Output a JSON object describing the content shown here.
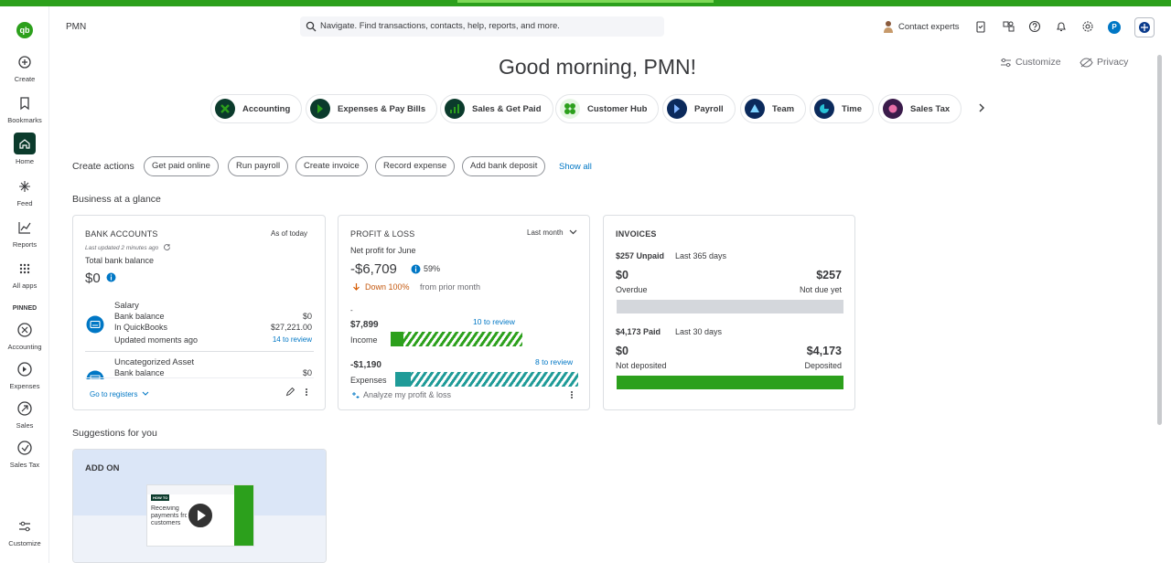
{
  "colors": {
    "brand_green": "#2ca01c",
    "dark_green": "#0b3b2c",
    "link_blue": "#0077c5",
    "teal": "#1f9b98"
  },
  "sidebar": {
    "logo": "qb",
    "items": [
      {
        "label": "Create",
        "icon": "plus-circle-icon"
      },
      {
        "label": "Bookmarks",
        "icon": "bookmark-icon"
      },
      {
        "label": "Home",
        "icon": "home-icon"
      },
      {
        "label": "Feed",
        "icon": "sparkle-icon"
      },
      {
        "label": "Reports",
        "icon": "chart-icon"
      },
      {
        "label": "All apps",
        "icon": "grid-icon"
      }
    ],
    "pinned_label": "PINNED",
    "pinned": [
      {
        "label": "Accounting",
        "icon": "accounting-icon"
      },
      {
        "label": "Expenses",
        "icon": "expenses-icon"
      },
      {
        "label": "Sales",
        "icon": "sales-icon"
      },
      {
        "label": "Sales Tax",
        "icon": "sales-tax-icon"
      }
    ],
    "customize_label": "Customize"
  },
  "header": {
    "company": "PMN",
    "search_placeholder": "Navigate. Find transactions, contacts, help, reports, and more.",
    "contact_label": "Contact experts",
    "avatar_letter": "P"
  },
  "greeting": "Good morning, PMN!",
  "top_links": {
    "customize": "Customize",
    "privacy": "Privacy"
  },
  "apps": [
    "Accounting",
    "Expenses & Pay Bills",
    "Sales & Get Paid",
    "Customer Hub",
    "Payroll",
    "Team",
    "Time",
    "Sales Tax"
  ],
  "create_actions": {
    "title": "Create actions",
    "buttons": [
      "Get paid online",
      "Run payroll",
      "Create invoice",
      "Record expense",
      "Add bank deposit"
    ],
    "show_all": "Show all"
  },
  "glance_title": "Business at a glance",
  "bank": {
    "title": "BANK ACCOUNTS",
    "as_of": "As of today",
    "updated": "Last updated 2 minutes ago",
    "total_label": "Total bank balance",
    "total": "$0",
    "accounts": [
      {
        "name": "Salary",
        "bank_label": "Bank balance",
        "bank_value": "$0",
        "qb_label": "In QuickBooks",
        "qb_value": "$27,221.00",
        "updated": "Updated moments ago",
        "review": "14 to review"
      },
      {
        "name": "Uncategorized Asset",
        "bank_label": "Bank balance",
        "bank_value": "$0"
      }
    ],
    "go_to_registers": "Go to registers"
  },
  "pl": {
    "title": "PROFIT & LOSS",
    "period": "Last month",
    "net_label": "Net profit for June",
    "net_value": "-$6,709",
    "pct": "59%",
    "change": "Down 100%",
    "change_suffix": "from prior month",
    "income_value": "$7,899",
    "income_label": "Income",
    "income_review": "10 to review",
    "expenses_value": "-$1,190",
    "expenses_label": "Expenses",
    "expenses_review": "8 to review",
    "analyze": "Analyze my profit & loss"
  },
  "invoices": {
    "title": "INVOICES",
    "unpaid_amount": "$257 Unpaid",
    "unpaid_period": "Last 365 days",
    "overdue_value": "$0",
    "overdue_label": "Overdue",
    "not_due_value": "$257",
    "not_due_label": "Not due yet",
    "paid_amount": "$4,173 Paid",
    "paid_period": "Last 30 days",
    "not_deposited_value": "$0",
    "not_deposited_label": "Not deposited",
    "deposited_value": "$4,173",
    "deposited_label": "Deposited"
  },
  "suggestions": {
    "title": "Suggestions for you",
    "card_label": "ADD ON",
    "thumb_tag": "HOW TO",
    "thumb_text": "Receiving payments from customers"
  }
}
